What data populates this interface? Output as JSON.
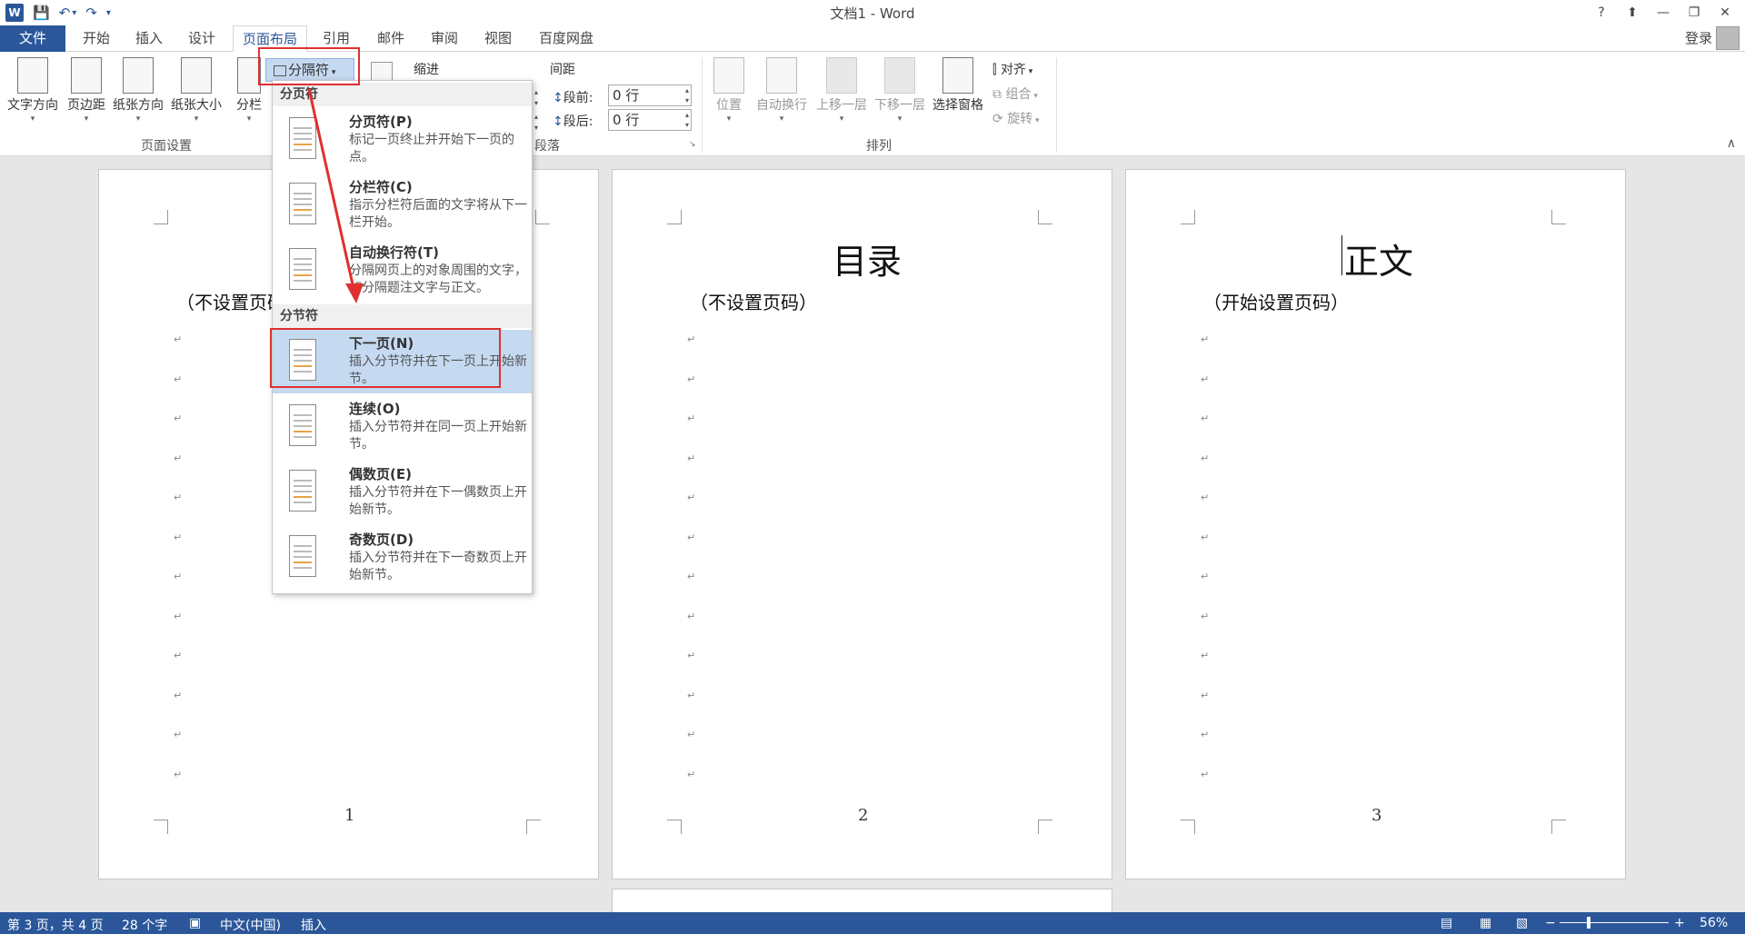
{
  "window": {
    "title": "文档1 - Word",
    "help": "?",
    "ribbon_display": "⬆",
    "minimize": "—",
    "restore": "❐",
    "close": "✕"
  },
  "qat": {
    "app_icon": "W",
    "save": "💾",
    "undo": "↶",
    "undo_dd": "▾",
    "redo": "↷",
    "customize": "▾"
  },
  "tabs": [
    "文件",
    "开始",
    "插入",
    "设计",
    "页面布局",
    "引用",
    "邮件",
    "审阅",
    "视图",
    "百度网盘"
  ],
  "active_tab": "页面布局",
  "account": {
    "login": "登录"
  },
  "ribbon": {
    "page_setup": {
      "buttons": [
        "文字方向",
        "页边距",
        "纸张方向",
        "纸张大小",
        "分栏"
      ],
      "group_label": "页面设置"
    },
    "breaks_button": "分隔符",
    "indent_label": "缩进",
    "spacing_label": "间距",
    "before_label": "段前:",
    "before_value": "0 行",
    "after_label": "段后:",
    "after_value": "0 行",
    "paragraph_label": "段落",
    "arrange": {
      "buttons": [
        "位置",
        "自动换行",
        "上移一层",
        "下移一层",
        "选择窗格"
      ],
      "align": "对齐",
      "group": "组合",
      "rotate": "旋转",
      "group_label": "排列"
    },
    "collapse": "∧"
  },
  "breaks_menu": {
    "page_breaks_header": "分页符",
    "section_breaks_header": "分节符",
    "items": [
      {
        "title": "分页符(P)",
        "desc": "标记一页终止并开始下一页的点。"
      },
      {
        "title": "分栏符(C)",
        "desc": "指示分栏符后面的文字将从下一栏开始。"
      },
      {
        "title": "自动换行符(T)",
        "desc": "分隔网页上的对象周围的文字，如分隔题注文字与正文。"
      },
      {
        "title": "下一页(N)",
        "desc": "插入分节符并在下一页上开始新节。"
      },
      {
        "title": "连续(O)",
        "desc": "插入分节符并在同一页上开始新节。"
      },
      {
        "title": "偶数页(E)",
        "desc": "插入分节符并在下一偶数页上开始新节。"
      },
      {
        "title": "奇数页(D)",
        "desc": "插入分节符并在下一奇数页上开始新节。"
      }
    ],
    "highlighted": "下一页(N)"
  },
  "pages": [
    {
      "heading": "",
      "subtitle": "（不设置页码）",
      "number": "1"
    },
    {
      "heading": "目录",
      "subtitle": "（不设置页码）",
      "number": "2"
    },
    {
      "heading": "正文",
      "subtitle": "（开始设置页码）",
      "number": "3"
    }
  ],
  "para_mark": "↵",
  "statusbar": {
    "page": "第 3 页，共 4 页",
    "words": "28 个字",
    "language": "中文(中国)",
    "mode": "插入",
    "zoom": "56%",
    "zoom_minus": "−",
    "zoom_plus": "+"
  },
  "colors": {
    "accent": "#2b579a",
    "highlight": "#c5d9f1",
    "annotation": "#e03030"
  }
}
